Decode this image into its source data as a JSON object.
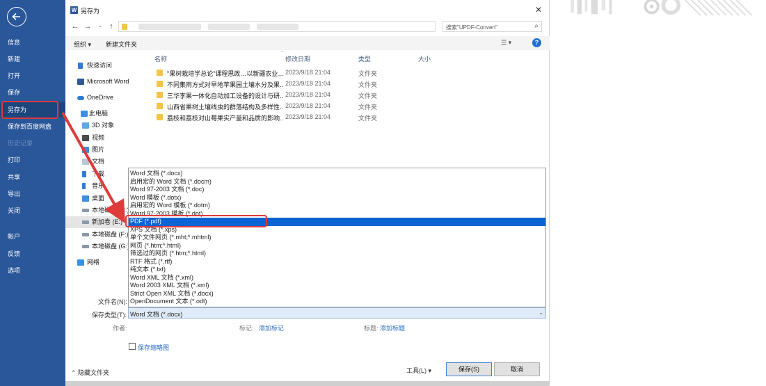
{
  "backstage": {
    "back_icon": "back-arrow-icon",
    "items": [
      {
        "label": "信息",
        "state": "normal"
      },
      {
        "label": "新建",
        "state": "normal"
      },
      {
        "label": "打开",
        "state": "normal"
      },
      {
        "label": "保存",
        "state": "normal"
      },
      {
        "label": "另存为",
        "state": "active"
      },
      {
        "label": "保存到百度网盘",
        "state": "normal"
      },
      {
        "label": "历史记录",
        "state": "disabled"
      },
      {
        "label": "打印",
        "state": "normal"
      },
      {
        "label": "共享",
        "state": "normal"
      },
      {
        "label": "导出",
        "state": "normal"
      },
      {
        "label": "关闭",
        "state": "normal"
      },
      {
        "label": "帐户",
        "state": "normal"
      },
      {
        "label": "反馈",
        "state": "normal"
      },
      {
        "label": "选项",
        "state": "normal"
      }
    ]
  },
  "dialog": {
    "title": "另存为",
    "close_label": "✕",
    "search_placeholder": "搜索\"UPDF-Convert\"",
    "toolbar": {
      "organize_label": "组织 ▾",
      "new_folder_label": "新建文件夹"
    },
    "nav": [
      {
        "label": "快速访问",
        "icon": "pin-icon"
      },
      {
        "label": "Microsoft Word",
        "icon": "word-icon"
      },
      {
        "label": "OneDrive",
        "icon": "cloud-icon"
      },
      {
        "label": "此电脑",
        "icon": "computer-icon"
      },
      {
        "label": "3D 对象",
        "icon": "cube-icon"
      },
      {
        "label": "视频",
        "icon": "video-icon"
      },
      {
        "label": "图片",
        "icon": "picture-icon"
      },
      {
        "label": "文档",
        "icon": "document-icon"
      },
      {
        "label": "下载",
        "icon": "download-icon"
      },
      {
        "label": "音乐",
        "icon": "music-icon"
      },
      {
        "label": "桌面",
        "icon": "desktop-icon"
      },
      {
        "label": "本地磁盘 (C:)",
        "icon": "drive-icon"
      },
      {
        "label": "新加卷 (E:)",
        "icon": "drive-icon"
      },
      {
        "label": "本地磁盘 (F:)",
        "icon": "drive-icon"
      },
      {
        "label": "本地磁盘 (G:)",
        "icon": "drive-icon"
      },
      {
        "label": "网络",
        "icon": "network-icon"
      }
    ],
    "columns": {
      "name": "名称",
      "date": "修改日期",
      "type": "类型",
      "size": "大小"
    },
    "files": [
      {
        "name": "\"果树栽培学总论\"课程思政…以新疆农业…",
        "date": "2023/9/18 21:04",
        "type": "文件夹"
      },
      {
        "name": "不同集雨方式对旱地苹果园土壤水分及果…",
        "date": "2023/9/18 21:04",
        "type": "文件夹"
      },
      {
        "name": "三华李果一体化自动加工设备的设计与研…",
        "date": "2023/9/18 21:04",
        "type": "文件夹"
      },
      {
        "name": "山西省果树土壤线虫的群落结构及多样性…",
        "date": "2023/9/18 21:04",
        "type": "文件夹"
      },
      {
        "name": "荔枝和荔枝对山莓果实产量和品质的影响…",
        "date": "2023/9/18 21:04",
        "type": "文件夹"
      }
    ],
    "filetype_options": [
      "Word 文档 (*.docx)",
      "启用宏的 Word 文档 (*.docm)",
      "Word 97-2003 文档 (*.doc)",
      "Word 模板 (*.dotx)",
      "启用宏的 Word 模板 (*.dotm)",
      "Word 97-2003 模板 (*.dot)",
      "PDF (*.pdf)",
      "XPS 文档 (*.xps)",
      "单个文件网页 (*.mht;*.mhtml)",
      "网页 (*.htm;*.html)",
      "筛选过的网页 (*.htm;*.html)",
      "RTF 格式 (*.rtf)",
      "纯文本 (*.txt)",
      "Word XML 文档 (*.xml)",
      "Word 2003 XML 文档 (*.xml)",
      "Strict Open XML 文档 (*.docx)",
      "OpenDocument 文本 (*.odt)"
    ],
    "selected_option": "PDF (*.pdf)",
    "filename_label": "文件名(N):",
    "savetype_label": "保存类型(T):",
    "savetype_value": "Word 文档 (*.docx)",
    "authors_label": "作者:",
    "tags_label": "标记:",
    "tags_link": "添加标记",
    "title_label": "标题:",
    "title_link": "添加标题",
    "thumbnail_label": "保存缩略图",
    "hide_folders_label": "隐藏文件夹",
    "tools_label": "工具(L)",
    "save_label": "保存(S)",
    "cancel_label": "取消"
  },
  "colors": {
    "backstage": "#2a579a",
    "highlight": "#0a64d3",
    "annotation": "#e03a3a",
    "folder": "#f3c447"
  }
}
